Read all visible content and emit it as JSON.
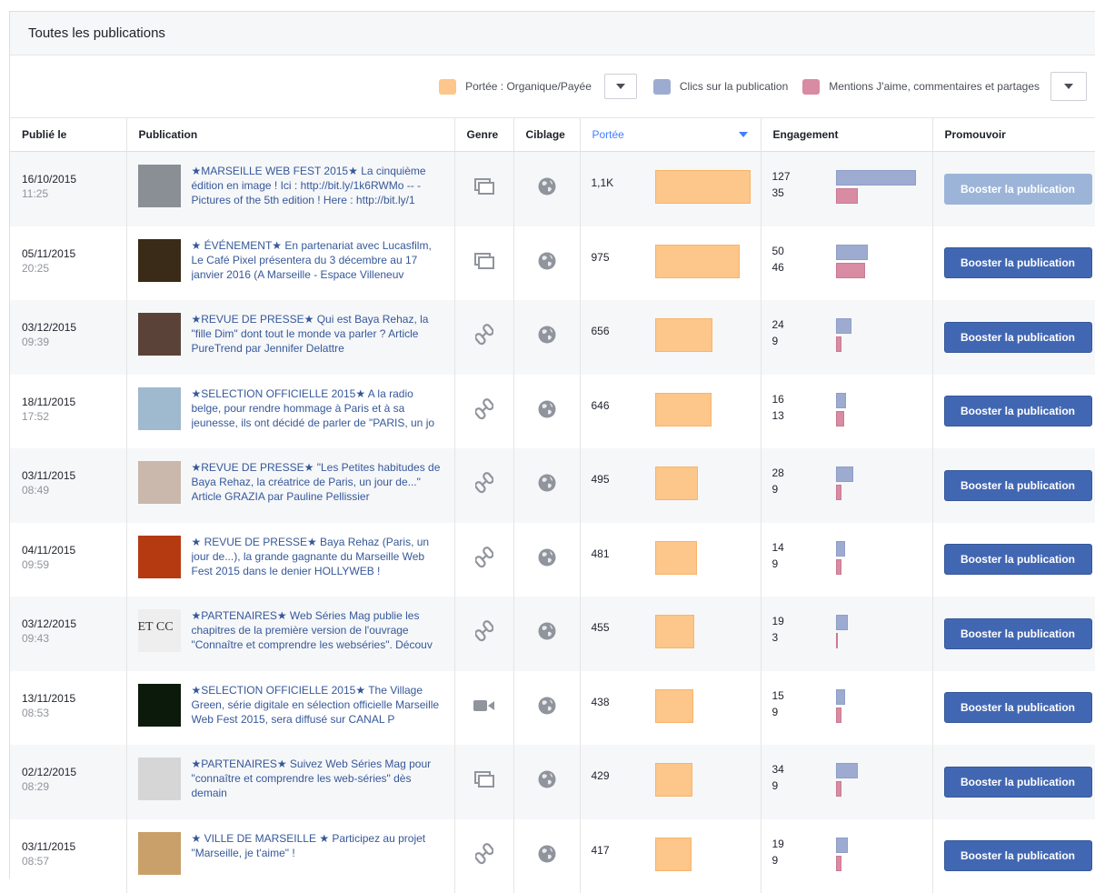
{
  "panel": {
    "title": "Toutes les publications"
  },
  "legend": {
    "reach_label": "Portée : Organique/Payée",
    "clicks_label": "Clics sur la publication",
    "likes_label": "Mentions J'aime, commentaires et partages",
    "colors": {
      "reach": "#fdc68a",
      "clicks": "#9dabd0",
      "likes": "#d88ba2"
    }
  },
  "columns": {
    "published": "Publié le",
    "post": "Publication",
    "type": "Genre",
    "targeting": "Ciblage",
    "reach": "Portée",
    "engagement": "Engagement",
    "promote": "Promouvoir"
  },
  "rows": [
    {
      "date": "16/10/2015",
      "time": "11:25",
      "text": "★MARSEILLE WEB FEST 2015★ La cinquième édition en image ! Ici : http://bit.ly/1k6RWMo -- - Pictures of the 5th edition ! Here : http://bit.ly/1",
      "type_icon": "album-icon",
      "reach": "1,1K",
      "reach_value": 1100,
      "clicks": "127",
      "clicks_value": 127,
      "likes": "35",
      "likes_value": 35,
      "boost": "Booster la publication",
      "boost_disabled": true,
      "thumb": "#8a8f96"
    },
    {
      "date": "05/11/2015",
      "time": "20:25",
      "text": "★ ÉVÉNEMENT★ En partenariat avec Lucasfilm, Le Café Pixel présentera du 3 décembre au 17 janvier 2016 (A Marseille - Espace Villeneuv",
      "type_icon": "album-icon",
      "reach": "975",
      "reach_value": 975,
      "clicks": "50",
      "clicks_value": 50,
      "likes": "46",
      "likes_value": 46,
      "boost": "Booster la publication",
      "boost_disabled": false,
      "thumb": "#3a2a18"
    },
    {
      "date": "03/12/2015",
      "time": "09:39",
      "text": "★REVUE DE PRESSE★ Qui est Baya Rehaz, la \"fille Dim\" dont tout le monde va parler ? Article PureTrend par Jennifer Delattre",
      "type_icon": "link-icon",
      "reach": "656",
      "reach_value": 656,
      "clicks": "24",
      "clicks_value": 24,
      "likes": "9",
      "likes_value": 9,
      "boost": "Booster la publication",
      "boost_disabled": false,
      "thumb": "#5a4238"
    },
    {
      "date": "18/11/2015",
      "time": "17:52",
      "text": "★SELECTION OFFICIELLE 2015★ A la radio belge, pour rendre hommage à Paris et à sa jeunesse, ils ont décidé de parler de \"PARIS, un jo",
      "type_icon": "link-icon",
      "reach": "646",
      "reach_value": 646,
      "clicks": "16",
      "clicks_value": 16,
      "likes": "13",
      "likes_value": 13,
      "boost": "Booster la publication",
      "boost_disabled": false,
      "thumb": "#9fb9cf"
    },
    {
      "date": "03/11/2015",
      "time": "08:49",
      "text": "★REVUE DE PRESSE★ \"Les Petites habitudes de Baya Rehaz, la créatrice de Paris, un jour de...\" Article GRAZIA par Pauline Pellissier",
      "type_icon": "link-icon",
      "reach": "495",
      "reach_value": 495,
      "clicks": "28",
      "clicks_value": 28,
      "likes": "9",
      "likes_value": 9,
      "boost": "Booster la publication",
      "boost_disabled": false,
      "thumb": "#c9b8ab"
    },
    {
      "date": "04/11/2015",
      "time": "09:59",
      "text": "★ REVUE DE PRESSE★ Baya Rehaz (Paris, un jour de...), la grande gagnante du Marseille Web Fest 2015 dans le denier HOLLYWEB !",
      "type_icon": "link-icon",
      "reach": "481",
      "reach_value": 481,
      "clicks": "14",
      "clicks_value": 14,
      "likes": "9",
      "likes_value": 9,
      "boost": "Booster la publication",
      "boost_disabled": false,
      "thumb": "#b53a12"
    },
    {
      "date": "03/12/2015",
      "time": "09:43",
      "text": "★PARTENAIRES★ Web Séries Mag publie les chapitres de la première version de l'ouvrage \"Connaître et comprendre les webséries\". Découv",
      "type_icon": "link-icon",
      "reach": "455",
      "reach_value": 455,
      "clicks": "19",
      "clicks_value": 19,
      "likes": "3",
      "likes_value": 3,
      "boost": "Booster la publication",
      "boost_disabled": false,
      "thumb": "#eeeeee",
      "thumb_text": "ET CC"
    },
    {
      "date": "13/11/2015",
      "time": "08:53",
      "text": "★SELECTION OFFICIELLE 2015★ The Village Green, série digitale en sélection officielle Marseille Web Fest 2015, sera diffusé sur CANAL P",
      "type_icon": "video-icon",
      "reach": "438",
      "reach_value": 438,
      "clicks": "15",
      "clicks_value": 15,
      "likes": "9",
      "likes_value": 9,
      "boost": "Booster la publication",
      "boost_disabled": false,
      "thumb": "#0c1a0c"
    },
    {
      "date": "02/12/2015",
      "time": "08:29",
      "text": "★PARTENAIRES★ Suivez Web Séries Mag pour \"connaître et comprendre les web-séries\" dès demain",
      "type_icon": "album-icon",
      "reach": "429",
      "reach_value": 429,
      "clicks": "34",
      "clicks_value": 34,
      "likes": "9",
      "likes_value": 9,
      "boost": "Booster la publication",
      "boost_disabled": false,
      "thumb": "#d6d6d6"
    },
    {
      "date": "03/11/2015",
      "time": "08:57",
      "text": "★ VILLE DE MARSEILLE ★ Participez au projet \"Marseille, je t'aime\" !",
      "type_icon": "link-icon",
      "reach": "417",
      "reach_value": 417,
      "clicks": "19",
      "clicks_value": 19,
      "likes": "9",
      "likes_value": 9,
      "boost": "Booster la publication",
      "boost_disabled": false,
      "thumb": "#c9a06a"
    }
  ]
}
